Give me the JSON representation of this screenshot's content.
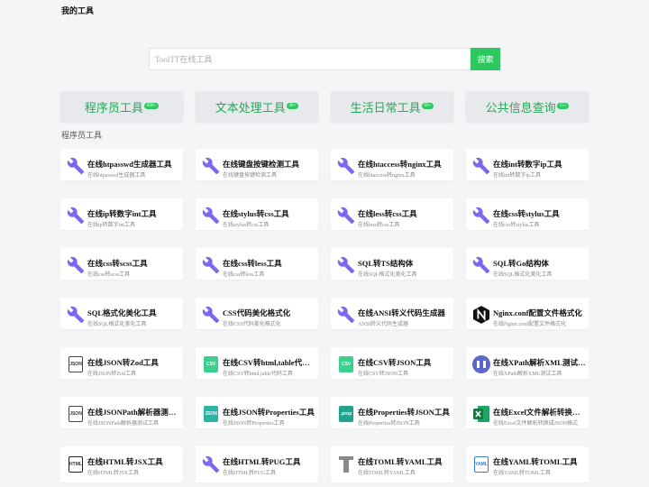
{
  "header": {
    "brand": "我的工具"
  },
  "search": {
    "placeholder": "ToolTT在线工具",
    "button": "搜索"
  },
  "colors": {
    "accent": "#2fc760",
    "wrench": "#7b68ee"
  },
  "categories": [
    {
      "label": "程序员工具",
      "badge": "600+"
    },
    {
      "label": "文本处理工具",
      "badge": "40+"
    },
    {
      "label": "生活日常工具",
      "badge": "60+"
    },
    {
      "label": "公共信息查询",
      "badge": "15+"
    }
  ],
  "section": {
    "title": "程序员工具"
  },
  "tools": [
    {
      "title": "在线htpasswd生成器工具",
      "sub": "在线htpasswd生成器工具",
      "icon": "wrench-icon"
    },
    {
      "title": "在线键盘按键检测工具",
      "sub": "在线键盘按键检测工具",
      "icon": "wrench-icon"
    },
    {
      "title": "在线htaccess转nginx工具",
      "sub": "在线htaccess转nginx工具",
      "icon": "wrench-icon"
    },
    {
      "title": "在线int转数字ip工具",
      "sub": "在线int转数字ip工具",
      "icon": "wrench-icon"
    },
    {
      "title": "在线ip转数字int工具",
      "sub": "在线ip转数字int工具",
      "icon": "wrench-icon"
    },
    {
      "title": "在线stylus转css工具",
      "sub": "在线stylus转css工具",
      "icon": "wrench-icon"
    },
    {
      "title": "在线less转css工具",
      "sub": "在线less转css工具",
      "icon": "wrench-icon"
    },
    {
      "title": "在线css转stylus工具",
      "sub": "在线css转stylus工具",
      "icon": "wrench-icon"
    },
    {
      "title": "在线css转scss工具",
      "sub": "在线css转scss工具",
      "icon": "wrench-icon"
    },
    {
      "title": "在线css转less工具",
      "sub": "在线css转less工具",
      "icon": "wrench-icon"
    },
    {
      "title": "SQL转TS结构体",
      "sub": "在线SQL格式化美化工具",
      "icon": "wrench-icon"
    },
    {
      "title": "SQL转Go结构体",
      "sub": "在线SQL格式化美化工具",
      "icon": "wrench-icon"
    },
    {
      "title": "SQL格式化美化工具",
      "sub": "在线SQL格式化美化工具",
      "icon": "wrench-icon"
    },
    {
      "title": "CSS代码美化格式化",
      "sub": "在线CSS代码美化格式化",
      "icon": "wrench-icon"
    },
    {
      "title": "在线ANSI转义代码生成器",
      "sub": "ANSI转义代码生成器",
      "icon": "wrench-icon"
    },
    {
      "title": "Nginx.conf配置文件格式化",
      "sub": "在线Nginx.conf配置文件格式化",
      "icon": "nginx-icon"
    },
    {
      "title": "在线JSON转Zod工具",
      "sub": "在线JSON转Zod工具",
      "icon": "json-file-icon"
    },
    {
      "title": "在线CSV转html,table代码工具",
      "sub": "在线CSV转html,table代码工具",
      "icon": "csv-icon"
    },
    {
      "title": "在线CSV转JSON工具",
      "sub": "在线CSV转JSON工具",
      "icon": "csv-icon"
    },
    {
      "title": "在线XPath解析XML测试工具",
      "sub": "在线XPath解析XML测试工具",
      "icon": "xpath-icon"
    },
    {
      "title": "在线JSONPath解析器测试工具",
      "sub": "在线JSONPath解析器测试工具",
      "icon": "json-file-icon"
    },
    {
      "title": "在线JSON转Properties工具",
      "sub": "在线JSON转Properties工具",
      "icon": "json-icon"
    },
    {
      "title": "在线Properties转JSON工具",
      "sub": "在线Properties转JSON工具",
      "icon": "prop-icon"
    },
    {
      "title": "在线Excel文件解析转换成JSON格式",
      "sub": "在线Excel文件解析转换成JSON格式",
      "icon": "excel-icon"
    },
    {
      "title": "在线HTML转JSX工具",
      "sub": "在线HTML转JSX工具",
      "icon": "html-icon"
    },
    {
      "title": "在线HTML转PUG工具",
      "sub": "在线HTML转PUG工具",
      "icon": "wrench-icon"
    },
    {
      "title": "在线TOML转YAML工具",
      "sub": "在线TOML转YAML工具",
      "icon": "toml-icon"
    },
    {
      "title": "在线YAML转TOML工具",
      "sub": "在线YAML转TOML工具",
      "icon": "yaml-icon"
    }
  ]
}
